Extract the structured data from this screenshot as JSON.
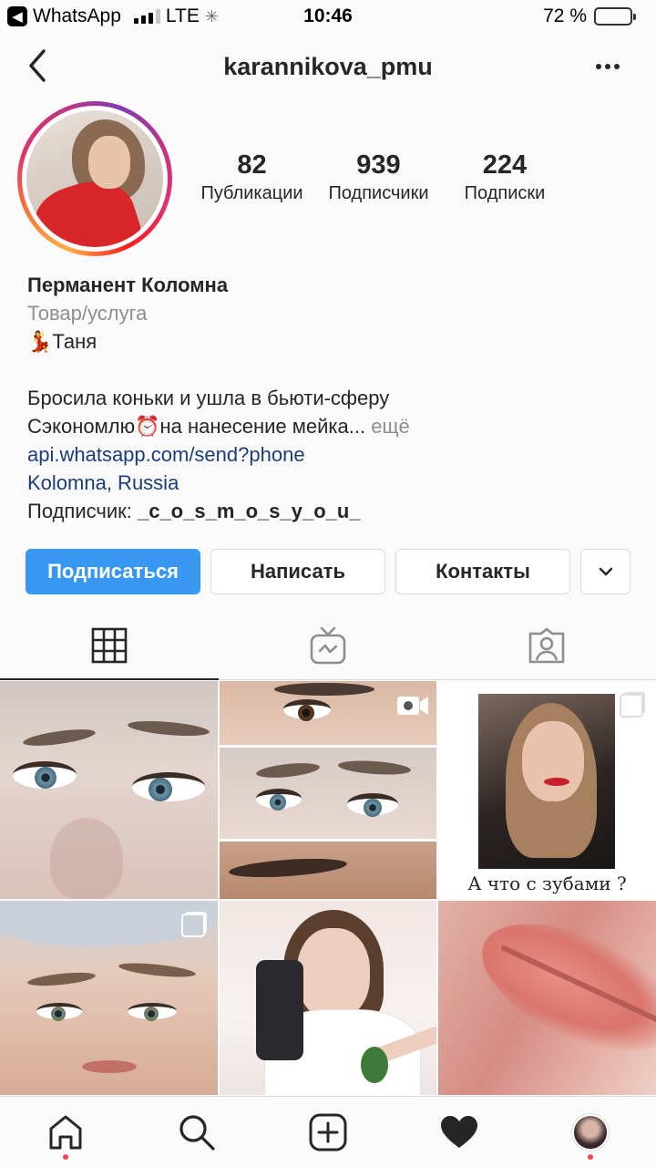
{
  "status_bar": {
    "back_app": "WhatsApp",
    "network": "LTE",
    "time": "10:46",
    "battery": "72 %",
    "battery_level": 0.72
  },
  "header": {
    "username": "karannikova_pmu"
  },
  "stats": [
    {
      "value": "82",
      "label": "Публикации"
    },
    {
      "value": "939",
      "label": "Подписчики"
    },
    {
      "value": "224",
      "label": "Подписки"
    }
  ],
  "bio": {
    "name": "Перманент Коломна",
    "category": "Товар/услуга",
    "line1": "💃Таня",
    "line2": "Бросила коньки и ушла в бьюти-сферу",
    "line3": "Сэкономлю⏰на нанесение мейка...",
    "more": " ещё",
    "link": "api.whatsapp.com/send?phone",
    "location": "Kolomna, Russia",
    "follower_label": "Подписчик: ",
    "follower_name": "_c_o_s_m_o_s_y_o_u_"
  },
  "actions": {
    "follow": "Подписаться",
    "message": "Написать",
    "contacts": "Контакты"
  },
  "grid": {
    "quote_caption": "А что с зубами ?"
  },
  "colors": {
    "accent": "#3897f0",
    "link": "#1b3d7a",
    "notification": "#ed4956"
  }
}
